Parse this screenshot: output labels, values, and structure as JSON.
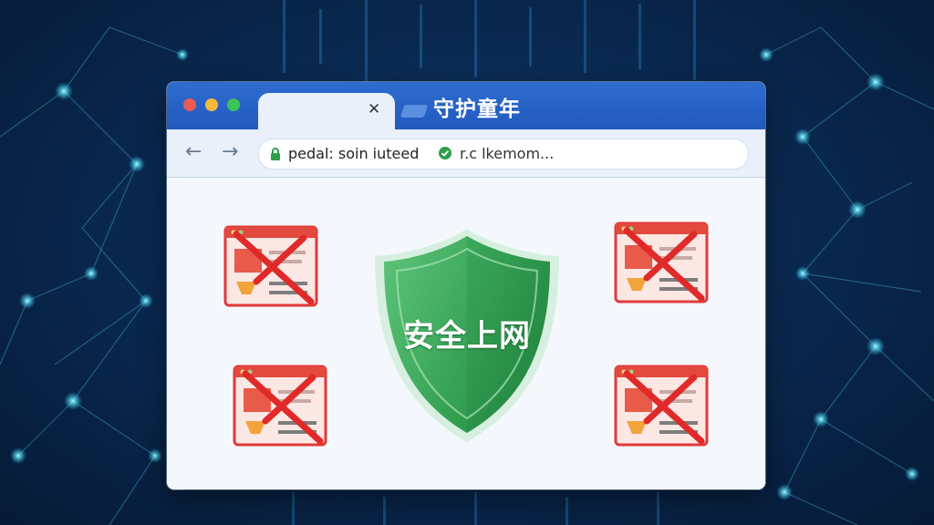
{
  "window": {
    "title": "守护童年",
    "tab_close_icon": "close-icon"
  },
  "toolbar": {
    "back_icon": "arrow-left-icon",
    "forward_icon": "arrow-right-icon",
    "address_part1": "pedal: soin iuteed",
    "address_part2": "r.c lkemom..."
  },
  "main": {
    "shield_label": "安全上网",
    "blocked_pages": [
      {
        "name": "blocked-page-top-left"
      },
      {
        "name": "blocked-page-bottom-left"
      },
      {
        "name": "blocked-page-top-right"
      },
      {
        "name": "blocked-page-bottom-right"
      }
    ]
  },
  "colors": {
    "accent": "#2561c6",
    "shield": "#35a85a",
    "block": "#e03a3a"
  }
}
